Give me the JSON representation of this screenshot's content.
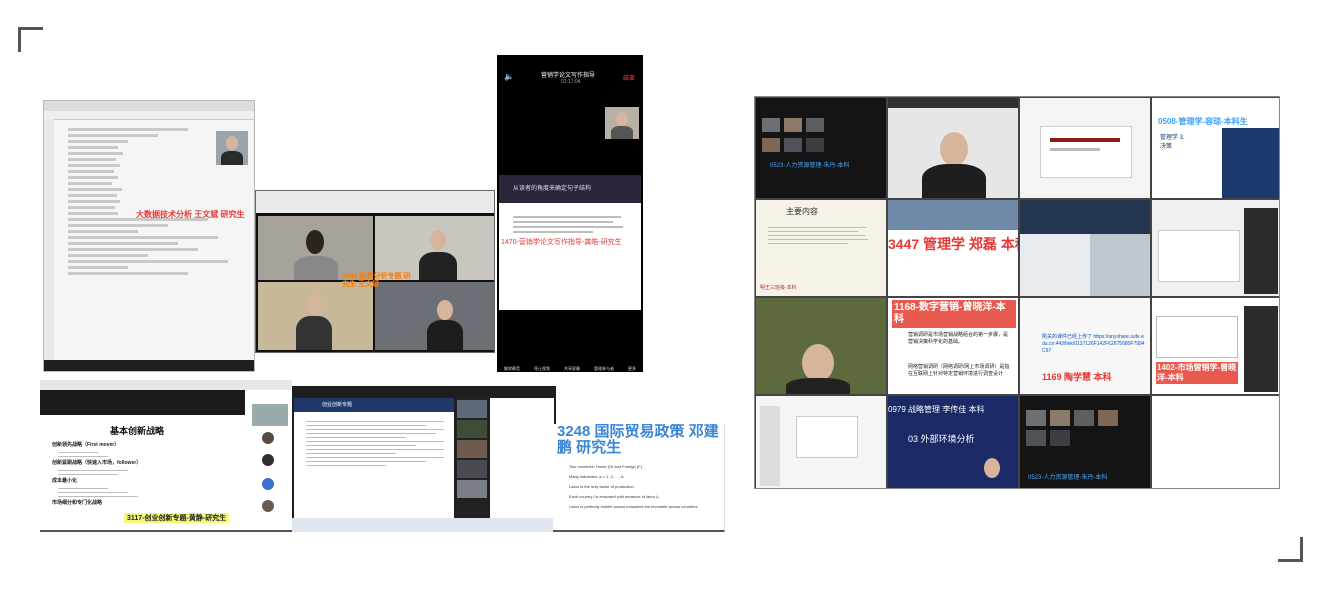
{
  "overlays": {
    "big_data_label": "大数据技术分析 王文斌 研究生",
    "zoom_meeting_label": "3444 投资分析专题 研究生 王文斌",
    "writing_title": "营销学论文写作指导",
    "writing_time": "01:17:04",
    "writing_exit": "结束",
    "writing_slide_title": "从读者的角度来确定句子结构",
    "writing_label": "1470-营销学论文写作指导-龚皓-研究生",
    "phone_bottom_controls": [
      "解除静音",
      "停止视频",
      "共享屏幕",
      "管理参与者",
      "更多"
    ],
    "innovation_title": "基本创新战略",
    "innovation_bullets": [
      "创新领先战略（First mover）",
      "创新紧跟战略（快速入市场，follower）",
      "成本最小化",
      "市场细分和专门化战略"
    ],
    "innovation_label": "3117-创业创新专题-黄静-研究生",
    "innovation_slide_header": "创业创新专题",
    "trade_label": "3248 国际贸易政策 邓建鹏 研究生",
    "trade_lines": [
      "Two countries: Home (H) and Foreign (F)",
      "Many industries: a = 1, 2, …, A",
      "Labor is the only factor of production",
      "Each country i is endowed with measure of labor Lᵢ",
      "Labor is perfectly mobile across industries but immobile across countries"
    ],
    "mgmt_label_1": "0508-管理学-容琼-本科生",
    "mgmt_slide_text": "管理学 3. 决策",
    "hr_label": "0523-人力资源管理-朱丹-本科",
    "mgmt_label_2": "3447 管理学 郑磊 本科",
    "mgmt_content": "主要内容",
    "digital_label": "1168-数字营销-曾晓洋-本科",
    "digital_text": "营销调研是市场营销战略组合的第一步骤，是营销决策科学化的基础。",
    "digital_text2": "网络营销调研（网络调研/网上市场调研）是指在互联网上针对特定营销环境进行调查设计",
    "chat_link_text": "刚关的课件已经上传了 https://anyshare.sufe.edu.cn:443/link/0137126F142F62675080F7994C97",
    "tao_label": "1169 陶学慧 本科",
    "market_label": "1402-市场营销学-曾晓洋-本科",
    "strategy_label": "0979 战略管理 李传佳 本科",
    "strategy_section": "03 外部环境分析",
    "hr_label_2": "0523-人力资源管理-朱丹-本科",
    "wang_label": "明王三班级·本科"
  }
}
